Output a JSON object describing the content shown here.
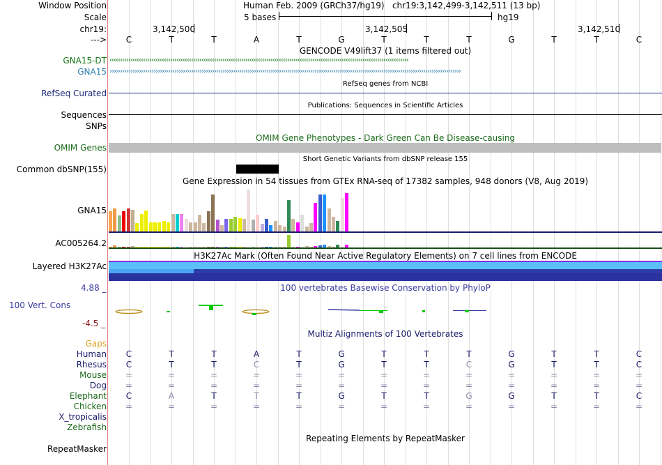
{
  "header": {
    "window_position_label": "Window Position",
    "scale_label": "Scale",
    "chrom_label": "chr19:",
    "strand_label": "--->",
    "position_title": "Human Feb. 2009 (GRCh37/hg19)   chr19:3,142,499-3,142,511 (13 bp)",
    "scale_text": "5 bases",
    "scale_assembly": "hg19",
    "coords": [
      "3,142,500",
      "3,142,505",
      "3,142,510"
    ]
  },
  "bases": [
    "C",
    "T",
    "T",
    "A",
    "T",
    "G",
    "T",
    "T",
    "T",
    "G",
    "T",
    "T",
    "C"
  ],
  "tracks": {
    "gencode": {
      "title": "GENCODE V49lift37 (1 items filtered out)",
      "genes": [
        "GNA15-DT",
        "GNA15"
      ],
      "colors": [
        "#1a7a1a",
        "#2f7fb0"
      ]
    },
    "refseq": {
      "label": "RefSeq Curated",
      "title": "RefSeq genes from NCBI"
    },
    "sequences": {
      "label": "Sequences",
      "title": "Publications: Sequences in Scientific Articles"
    },
    "snps": {
      "label": "SNPs"
    },
    "omim": {
      "label": "OMIM Genes",
      "title": "OMIM Gene Phenotypes - Dark Green Can Be Disease-causing"
    },
    "dbsnp": {
      "label": "Common dbSNP(155)",
      "title": "Short Genetic Variants from dbSNP release 155"
    },
    "gtex": {
      "title": "Gene Expression in 54 tissues from GTEx RNA-seq of 17382 samples, 948 donors (V8, Aug 2019)",
      "genes": [
        "GNA15",
        "AC005264.2"
      ],
      "expression_levels": [
        0.48,
        0.55,
        0.38,
        0.48,
        0.55,
        0.52,
        0.2,
        0.42,
        0.5,
        0.22,
        0.22,
        0.22,
        0.25,
        0.22,
        0.42,
        0.42,
        0.42,
        0.3,
        0.22,
        0.22,
        0.4,
        0.2,
        0.48,
        0.88,
        0.28,
        0.15,
        0.3,
        0.3,
        0.35,
        0.32,
        0.3,
        1.0,
        0.28,
        0.4,
        0.18,
        0.3,
        0.15,
        0.25,
        0.15,
        0.12,
        0.75,
        0.3,
        0.22,
        0.4,
        0.12,
        0.2,
        0.68,
        0.88,
        0.88,
        0.55,
        0.35,
        0.25,
        0.8,
        0.92
      ],
      "expression_colors": [
        "#ffa54f",
        "#ee9a49",
        "#8fbc8f",
        "#ee0000",
        "#cd3333",
        "#c0b090",
        "#eeee00",
        "#eeee00",
        "#eeee00",
        "#eeee00",
        "#eeee00",
        "#eeee00",
        "#eeee00",
        "#eeee00",
        "#cdb79e",
        "#00ced1",
        "#ee82ee",
        "#eedddd",
        "#cdb79e",
        "#cdb79e",
        "#cdb79e",
        "#cdb79e",
        "#8b7355",
        "#8b7355",
        "#b452cd",
        "#cdb79e",
        "#7a67ee",
        "#9acd32",
        "#9acd32",
        "#eeee00",
        "#cdb79e",
        "#eedddd",
        "#b0b0b0",
        "#ffcccc",
        "#c0b0e0",
        "#3a5fcd",
        "#1e90ff",
        "#cdb79e",
        "#cdb79e",
        "#cdb79e",
        "#2e8b57",
        "#cdb79e",
        "#ff00ff",
        "#dddddd",
        "#cdb79e",
        "#cdb79e",
        "#ff00ff",
        "#3a5fcd",
        "#1e90ff",
        "#cdb79e",
        "#cdb79e",
        "#2e8b57",
        "#eedddd",
        "#ff00ff"
      ]
    },
    "h3k27ac": {
      "label": "Layered H3K27Ac",
      "title": "H3K27Ac Mark (Often Found Near Active Regulatory Elements) on 7 cell lines from ENCODE"
    },
    "cons": {
      "label": "100 Vert. Cons",
      "title": "100 vertebrates Basewise Conservation by PhyloP",
      "max": "4.88 _",
      "min": "-4.5 _"
    },
    "multiz": {
      "title": "Multiz Alignments of 100 Vertebrates",
      "gaps_label": "Gaps",
      "species": [
        {
          "name": "Human",
          "seq": [
            "C",
            "T",
            "T",
            "A",
            "T",
            "G",
            "T",
            "T",
            "T",
            "G",
            "T",
            "T",
            "C"
          ]
        },
        {
          "name": "Rhesus",
          "seq": [
            "C",
            "T",
            "T",
            "C",
            "T",
            "G",
            "T",
            "T",
            "C",
            "G",
            "T",
            "T",
            "C"
          ]
        },
        {
          "name": "Mouse",
          "seq": [
            "=",
            "=",
            "=",
            "=",
            "=",
            "=",
            "=",
            "=",
            "=",
            "=",
            "=",
            "=",
            "="
          ]
        },
        {
          "name": "Dog",
          "seq": [
            "=",
            "=",
            "=",
            "=",
            "=",
            "=",
            "=",
            "=",
            "=",
            "=",
            "=",
            "=",
            "="
          ]
        },
        {
          "name": "Elephant",
          "seq": [
            "C",
            "A",
            "T",
            "T",
            "T",
            "G",
            "T",
            "T",
            "G",
            "G",
            "T",
            "T",
            "C"
          ]
        },
        {
          "name": "Chicken",
          "seq": [
            "=",
            "=",
            "=",
            "=",
            "=",
            "=",
            "=",
            "=",
            "=",
            "=",
            "=",
            "=",
            "="
          ]
        },
        {
          "name": "X_tropicalis",
          "seq": []
        },
        {
          "name": "Zebrafish",
          "seq": []
        }
      ]
    },
    "repeatmasker": {
      "label": "RepeatMasker",
      "title": "Repeating Elements by RepeatMasker"
    }
  }
}
